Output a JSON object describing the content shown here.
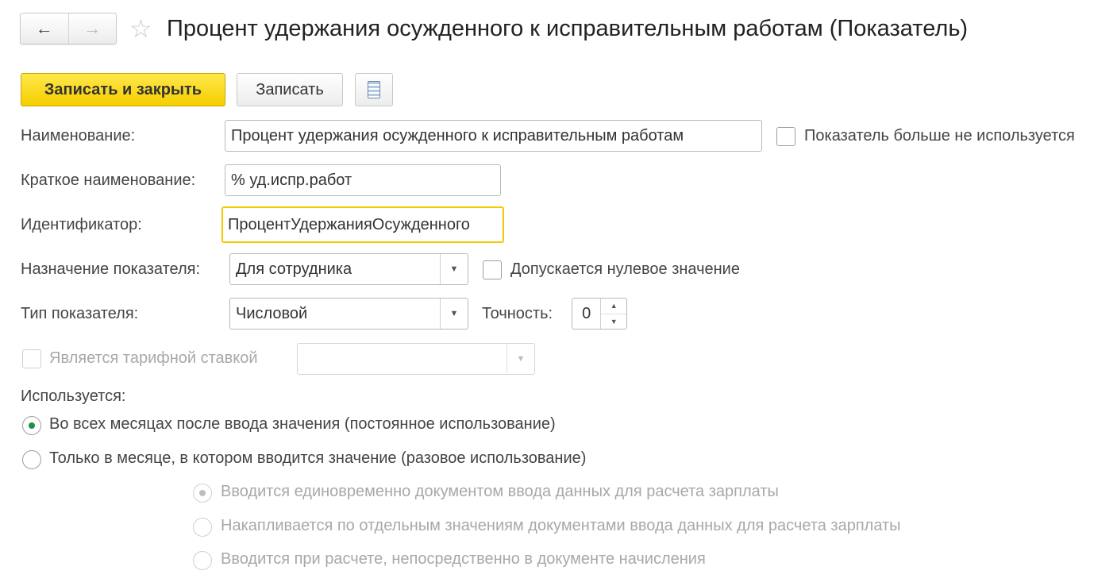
{
  "nav": {
    "back_icon": "←",
    "forward_icon": "→",
    "star_icon": "☆"
  },
  "title": "Процент удержания осужденного к исправительным работам (Показатель)",
  "toolbar": {
    "save_close_label": "Записать и закрыть",
    "save_label": "Записать",
    "report_icon": "document-list-icon"
  },
  "form": {
    "name_label": "Наименование:",
    "name_value": "Процент удержания осужденного к исправительным работам",
    "not_used_label": "Показатель больше не используется",
    "short_name_label": "Краткое наименование:",
    "short_name_value": "% уд.испр.работ",
    "identifier_label": "Идентификатор:",
    "identifier_value": "ПроцентУдержанияОсужденного",
    "purpose_label": "Назначение показателя:",
    "purpose_value": "Для сотрудника",
    "zero_allowed_label": "Допускается нулевое значение",
    "type_label": "Тип показателя:",
    "type_value": "Числовой",
    "precision_label": "Точность:",
    "precision_value": "0",
    "tariff_label": "Является тарифной ставкой",
    "tariff_value": "",
    "used_label": "Используется:",
    "usage_options": [
      "Во всех месяцах после ввода значения (постоянное использование)",
      "Только в месяце, в котором вводится значение (разовое использование)"
    ],
    "entry_options": [
      "Вводится единовременно документом ввода данных для расчета зарплаты",
      "Накапливается по отдельным значениям документами ввода данных для расчета зарплаты",
      "Вводится при расчете, непосредственно в документе начисления"
    ]
  },
  "colors": {
    "primary_button": "#f5cf00",
    "focus_border": "#f5c800",
    "radio_selected": "#1f8f47"
  }
}
